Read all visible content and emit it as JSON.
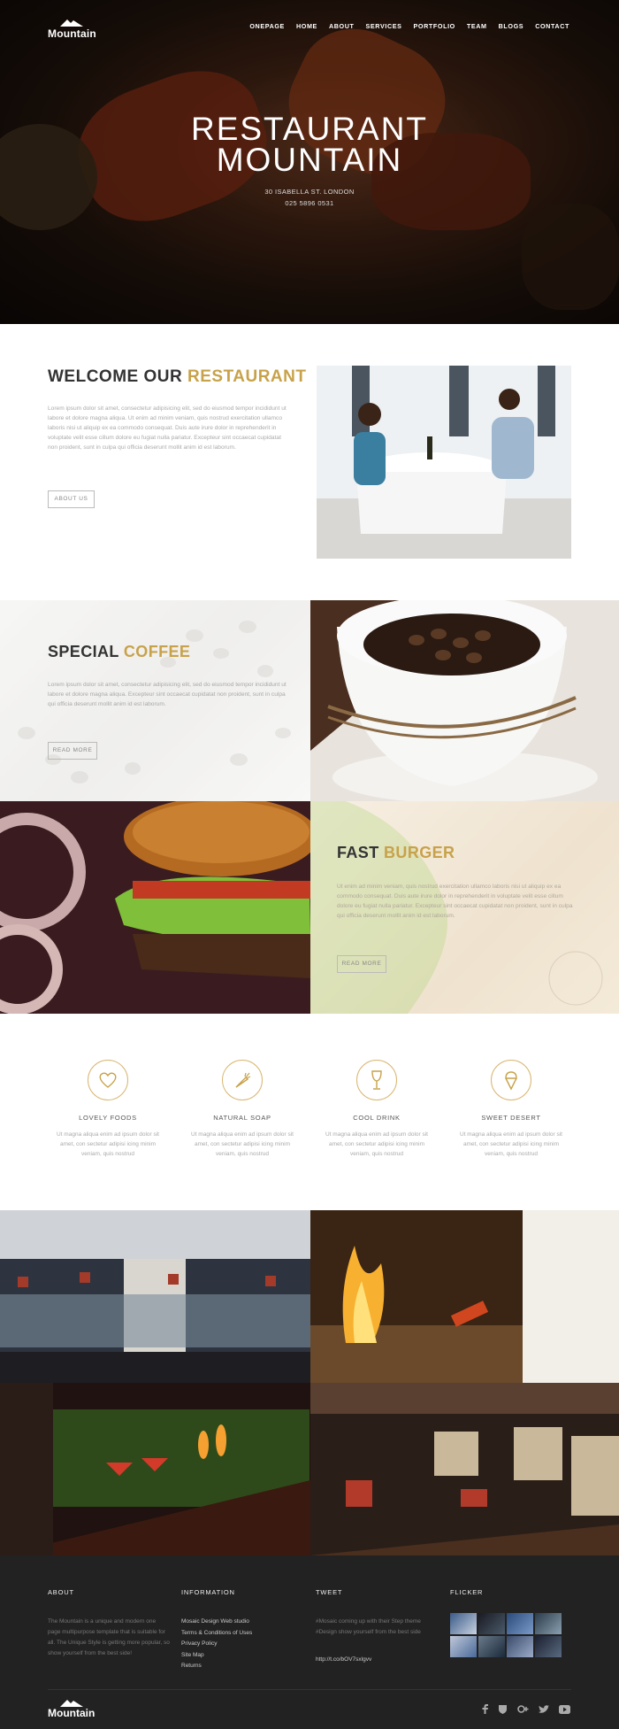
{
  "brand": {
    "name": "Mountain"
  },
  "nav": {
    "items": [
      "ONEPAGE",
      "HOME",
      "ABOUT",
      "SERVICES",
      "PORTFOLIO",
      "TEAM",
      "BLOGS",
      "CONTACT"
    ]
  },
  "hero": {
    "title_line1": "RESTAURANT",
    "title_line2": "MOUNTAIN",
    "address": "30 ISABELLA ST. LONDON",
    "phone": "025 5896 0531"
  },
  "welcome": {
    "title_plain": "WELCOME OUR ",
    "title_accent": "RESTAURANT",
    "text": "Lorem ipsum dolor sit amet, consectetur adipisicing elit, sed do eiusmod tempor incididunt ut labore et dolore magna aliqua. Ut enim ad minim veniam, quis nostrud exercitation ullamco laboris nisi ut aliquip ex ea commodo consequat. Duis aute irure dolor in reprehenderit in voluptate velit esse cillum dolore eu fugiat nulla pariatur. Excepteur sint occaecat cupidatat non proident, sunt in culpa qui officia deserunt mollit anim id est laborum.",
    "button": "ABOUT US"
  },
  "coffee": {
    "title_plain": "SPECIAL ",
    "title_accent": "COFFEE",
    "text": "Lorem ipsum dolor sit amet, consectetur adipisicing elit, sed do eiusmod tempor incididunt ut labore et dolore magna aliqua. Excepteur sint occaecat cupidatat non proident, sunt in culpa qui officia deserunt mollit anim id est laborum.",
    "button": "READ MORE"
  },
  "burger": {
    "title_plain": "FAST ",
    "title_accent": "BURGER",
    "text": "Ut enim ad minim veniam, quis nostrud exercitation ullamco laboris nisi ut aliquip ex ea commodo consequat. Duis aute irure dolor in reprehenderit in voluptate velit esse cillum dolore eu fugiat nulla pariatur. Excepteur sint occaecat cupidatat non proident, sunt in culpa qui officia deserunt mollit anim id est laborum.",
    "button": "READ MORE"
  },
  "features": [
    {
      "icon": "heart-icon",
      "title": "LOVELY FOODS",
      "text": "Ut magna aliqua enim ad ipsum dolor sit amet, con sectetur adipisi icing minim veniam, quis nostrud"
    },
    {
      "icon": "carrot-icon",
      "title": "NATURAL SOAP",
      "text": "Ut magna aliqua enim ad ipsum dolor sit amet, con sectetur adipisi icing minim veniam, quis nostrud"
    },
    {
      "icon": "wine-glass-icon",
      "title": "COOL DRINK",
      "text": "Ut magna aliqua enim ad ipsum dolor sit amet, con sectetur adipisi icing minim veniam, quis nostrud"
    },
    {
      "icon": "ice-cream-icon",
      "title": "SWEET DESERT",
      "text": "Ut magna aliqua enim ad ipsum dolor sit amet, con sectetur adipisi icing minim veniam, quis nostrud"
    }
  ],
  "footer": {
    "about_heading": "ABOUT",
    "about_text": "The Mountain is a unique and modern one page multipurpose template that is suitable for all. The Unique Style is getting more popular, so show yourself from the best side!",
    "info_heading": "INFORMATION",
    "info_links": [
      "Mosaic Design Web studio",
      "Terms & Conditions of Uses",
      "Privacy Policy",
      "Site Map",
      "Returns"
    ],
    "tweet_heading": "TWEET",
    "tweet_text": "#Mosaic coming up with their Step theme #Design show yourself from the best side",
    "tweet_link": "http://t.co/bOV7sxlgvv",
    "flicker_heading": "FLICKER",
    "social": [
      "facebook-icon",
      "shield-icon",
      "google-plus-icon",
      "twitter-icon",
      "youtube-icon"
    ]
  },
  "colors": {
    "accent": "#c8a24a",
    "footer_bg": "#222222",
    "text_muted": "#aaaaaa"
  }
}
